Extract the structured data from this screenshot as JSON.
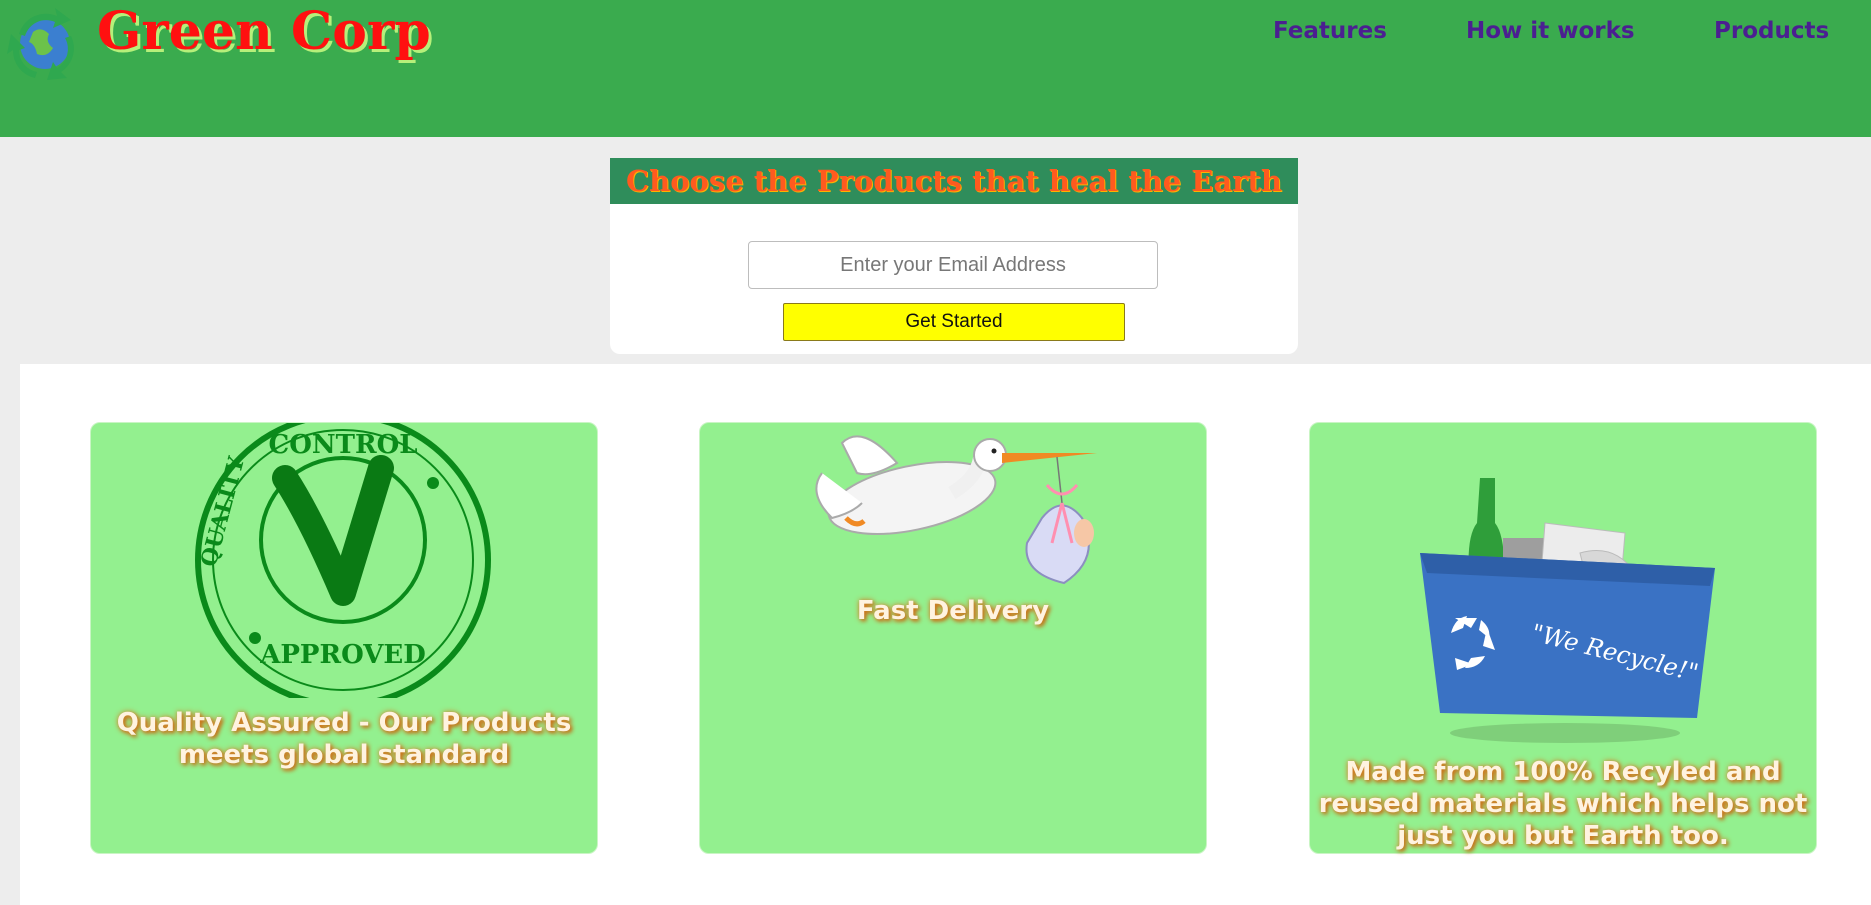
{
  "header": {
    "brand": "Green Corp",
    "nav": [
      "Features",
      "How it works",
      "Products"
    ]
  },
  "hero": {
    "title": "Choose the Products that heal the Earth",
    "email_placeholder": "Enter your Email Address",
    "cta_label": "Get Started"
  },
  "features": [
    {
      "icon": "quality-approved-stamp-icon",
      "text": "Quality Assured - Our Products meets global standard"
    },
    {
      "icon": "stork-delivery-icon",
      "text": "Fast Delivery"
    },
    {
      "icon": "recycle-bin-icon",
      "text": "Made from 100% Recyled and reused materials which helps not just you but Earth too.",
      "bin_label": "\"We Recycle!\""
    }
  ],
  "colors": {
    "header_bg": "#3aab4e",
    "brand": "#ff1010",
    "nav": "#4b1f91",
    "hero_title_bg": "#2f8d5b",
    "hero_title_text": "#ff5a1f",
    "cta_bg": "#ffff00",
    "card_bg": "#93f08f"
  }
}
